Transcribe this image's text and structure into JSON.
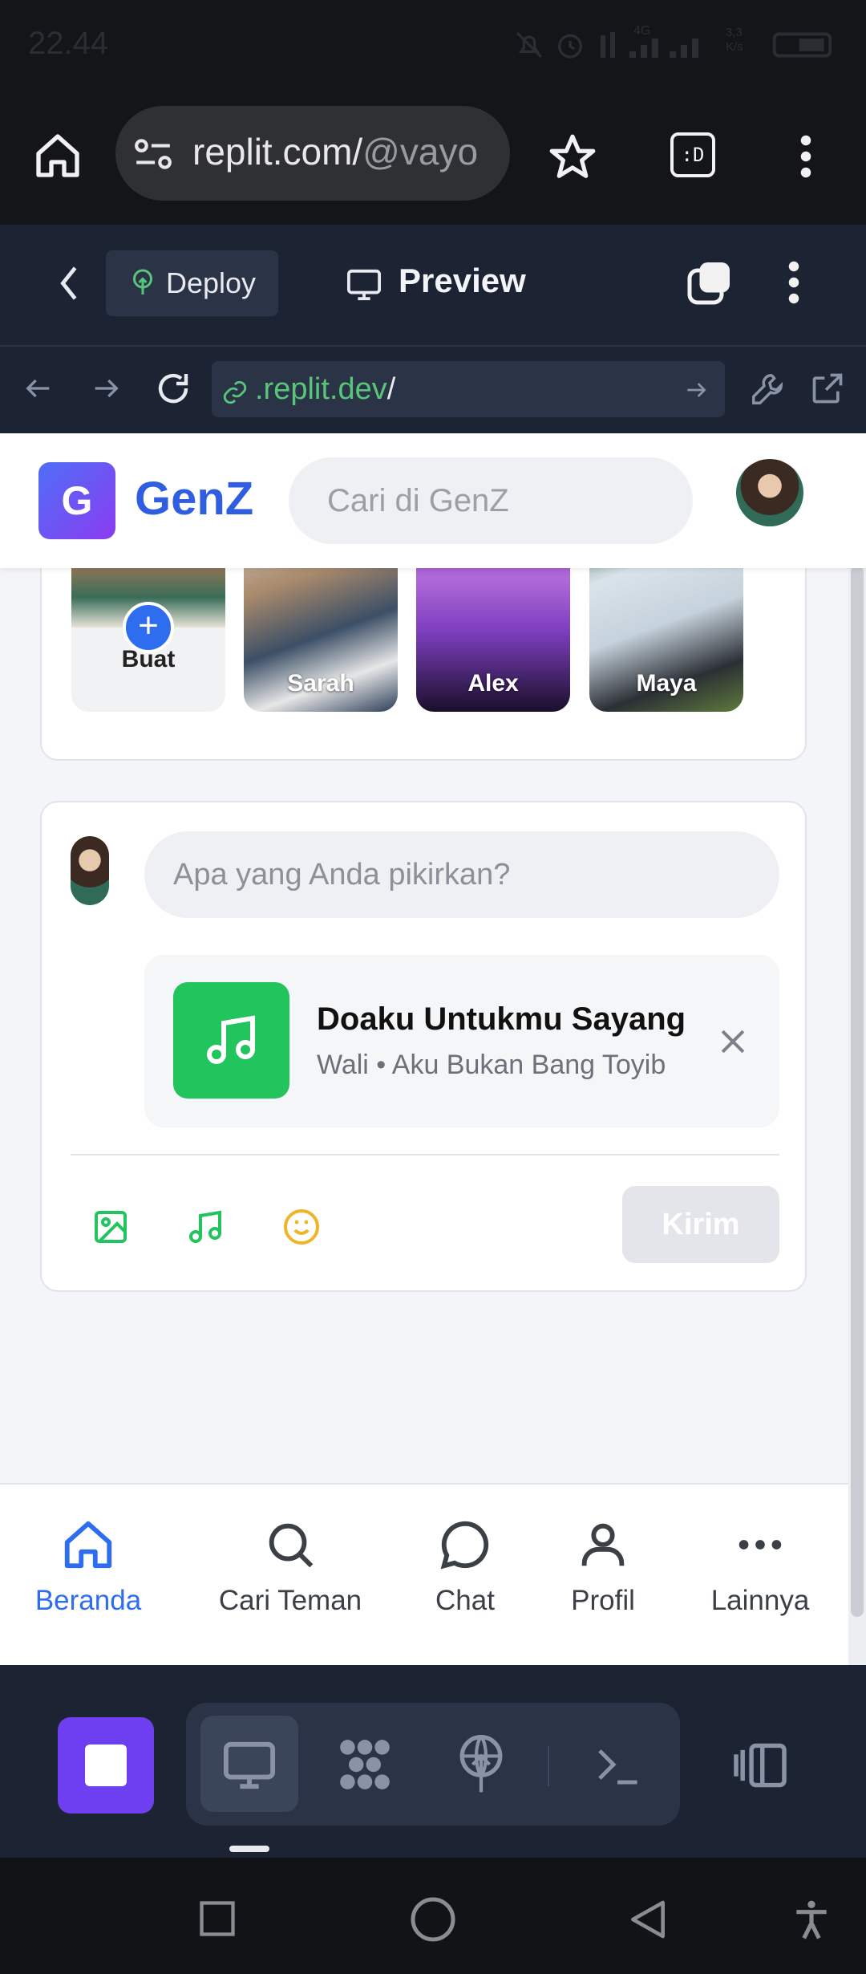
{
  "status_bar": {
    "time": "22.44",
    "network": "4G",
    "speed": "3,3 K/s"
  },
  "browser": {
    "url": "replit.com/",
    "url_dim": "@vayo"
  },
  "replit_toolbar": {
    "deploy_label": "Deploy",
    "preview_label": "Preview"
  },
  "preview_nav": {
    "url_domain": ".replit.dev",
    "url_path": "/"
  },
  "app": {
    "logo_letter": "G",
    "logo_text": "GenZ",
    "search_placeholder": "Cari di GenZ",
    "stories": [
      {
        "name": "Buat"
      },
      {
        "name": "Sarah"
      },
      {
        "name": "Alex"
      },
      {
        "name": "Maya"
      }
    ],
    "composer": {
      "placeholder": "Apa yang Anda pikirkan?",
      "music": {
        "title": "Doaku Untukmu Sayang",
        "subtitle": "Wali • Aku Bukan Bang Toyib"
      },
      "send_label": "Kirim"
    },
    "bottom_nav": [
      {
        "label": "Beranda",
        "active": true
      },
      {
        "label": "Cari Teman"
      },
      {
        "label": "Chat"
      },
      {
        "label": "Profil"
      },
      {
        "label": "Lainnya"
      }
    ]
  },
  "colors": {
    "accent": "#2f6df0",
    "music_green": "#21c45d",
    "emoji_yellow": "#f0b429",
    "replit_bg": "#1c2333",
    "stop_purple": "#6d3ff0"
  }
}
